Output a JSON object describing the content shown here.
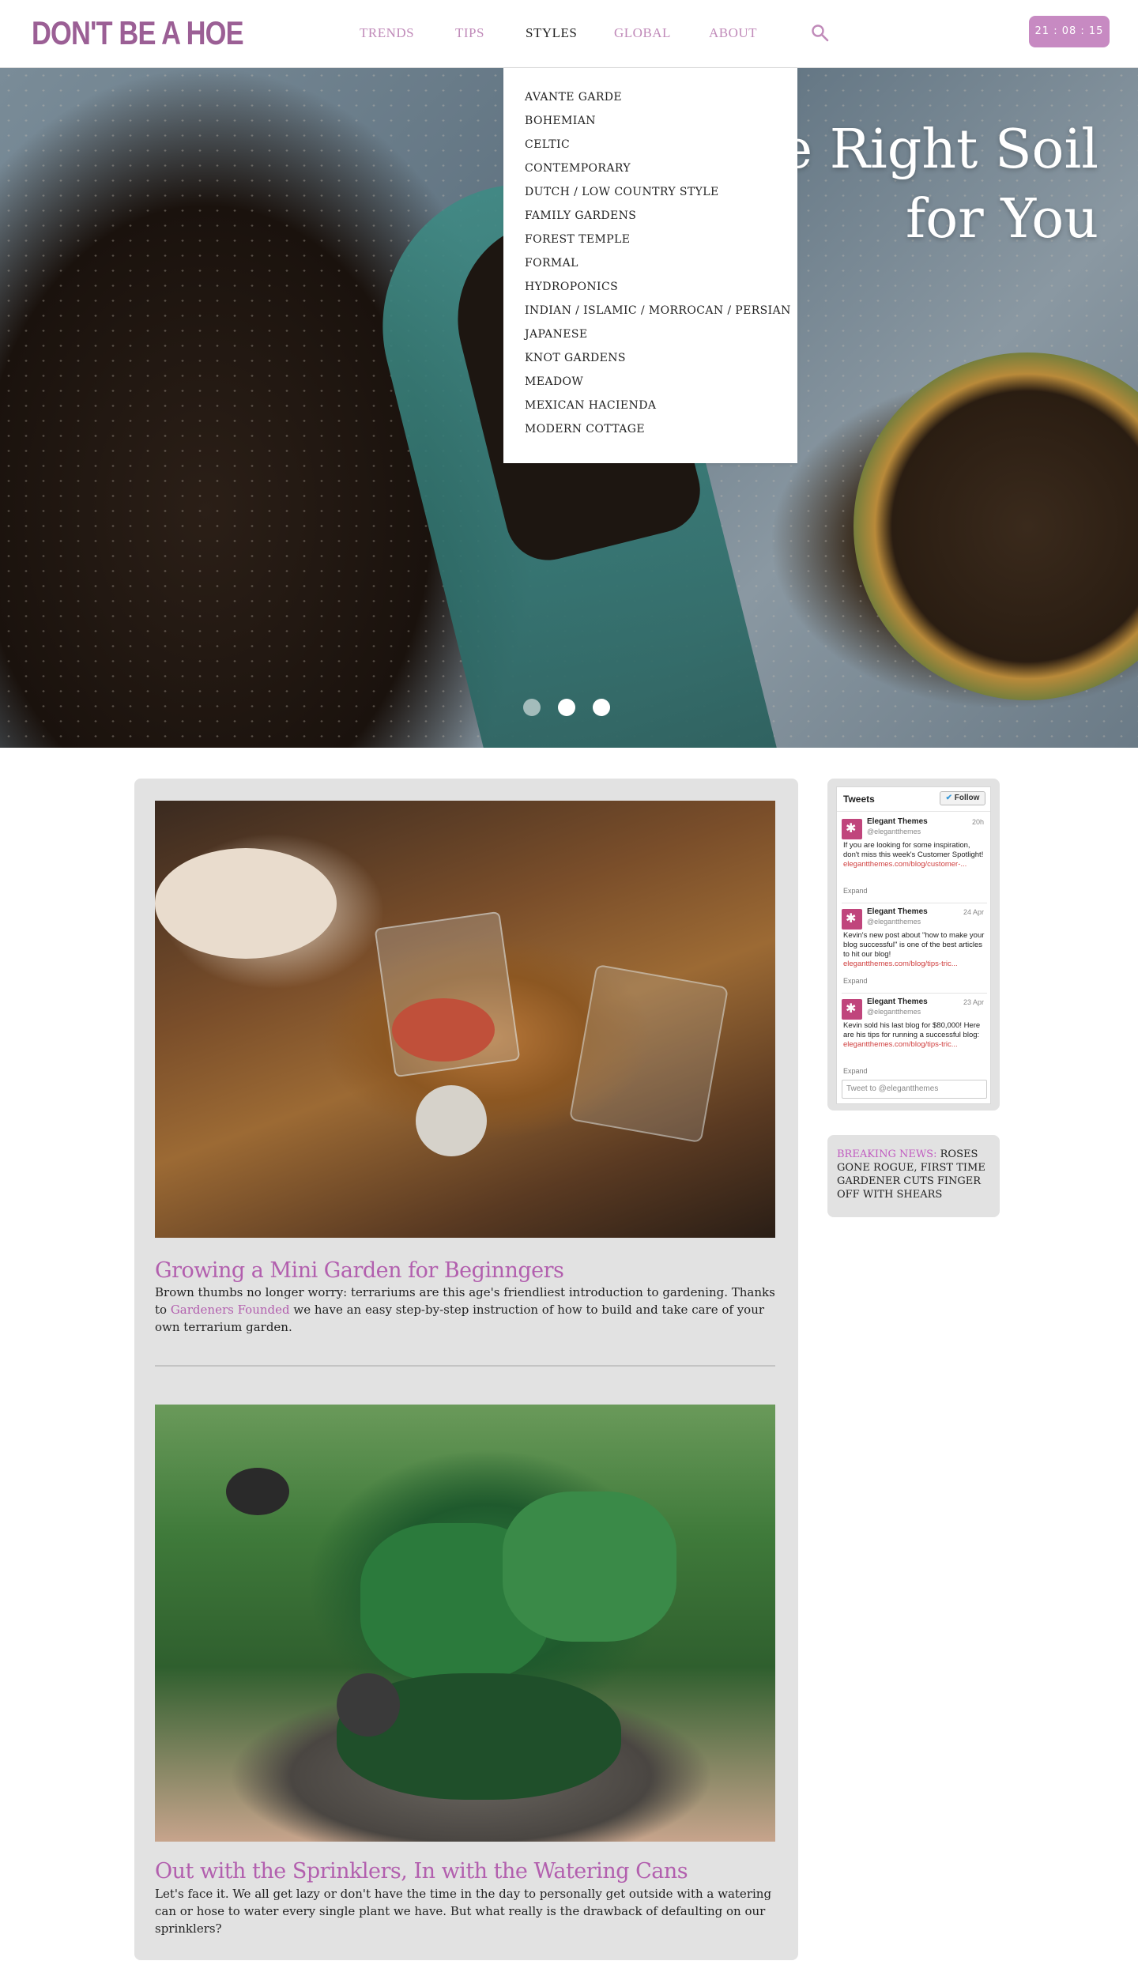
{
  "header": {
    "logo": "DON'T BE A HOE",
    "nav": [
      "TRENDS",
      "TIPS",
      "STYLES",
      "GLOBAL",
      "ABOUT"
    ],
    "active_nav": "STYLES",
    "clock": "21 : 08 : 15",
    "accent_color": "#9b5f95"
  },
  "dropdown": {
    "items": [
      "AVANTE GARDE",
      "BOHEMIAN",
      "CELTIC",
      "CONTEMPORARY",
      "DUTCH / LOW COUNTRY STYLE",
      "FAMILY GARDENS",
      "FOREST TEMPLE",
      "FORMAL",
      "HYDROPONICS",
      "INDIAN / ISLAMIC / MORROCAN / PERSIAN",
      "JAPANESE",
      "KNOT GARDENS",
      "MEADOW",
      "MEXICAN HACIENDA",
      "MODERN COTTAGE"
    ]
  },
  "hero": {
    "title_line1": "e Right Soil",
    "title_line2": "for You",
    "active_slide": 3
  },
  "posts": [
    {
      "title": "Growing a Mini Garden for Beginngers",
      "excerpt_pre": "Brown thumbs no longer worry: terrariums are this age's friendliest introduction to gardening. Thanks to ",
      "excerpt_link": "Gardeners Founded",
      "excerpt_post": " we have an easy step-by-step instruction of how to build and take care of your own terrarium garden."
    },
    {
      "title": "Out with the Sprinklers, In with the Watering Cans",
      "excerpt": "Let's face it. We all get lazy or don't have the time in the day to personally get outside with a watering can or hose to water every single plant we have. But what really is the drawback of defaulting on our sprinklers?"
    }
  ],
  "tweets": {
    "heading": "Tweets",
    "follow_label": "Follow",
    "items": [
      {
        "name": "Elegant Themes",
        "handle": "@elegantthemes",
        "time": "20h",
        "text": "If you are looking for some inspiration, don't miss this week's Customer Spotlight!",
        "link": "elegantthemes.com/blog/customer-...",
        "expand": "Expand"
      },
      {
        "name": "Elegant Themes",
        "handle": "@elegantthemes",
        "time": "24 Apr",
        "text": "Kevin's new post about \"how to make your blog successful\" is one of the best articles to hit our blog!",
        "link": "elegantthemes.com/blog/tips-tric...",
        "expand": "Expand"
      },
      {
        "name": "Elegant Themes",
        "handle": "@elegantthemes",
        "time": "23 Apr",
        "text": "Kevin sold his last blog for $80,000! Here are his tips for running a successful blog:",
        "link": "elegantthemes.com/blog/tips-tric...",
        "expand": "Expand"
      }
    ],
    "input_placeholder": "Tweet to @elegantthemes"
  },
  "breaking_news": {
    "label": "BREAKING NEWS:",
    "text": " ROSES GONE ROGUE, FIRST TIME GARDENER CUTS FINGER OFF WITH SHEARS"
  }
}
